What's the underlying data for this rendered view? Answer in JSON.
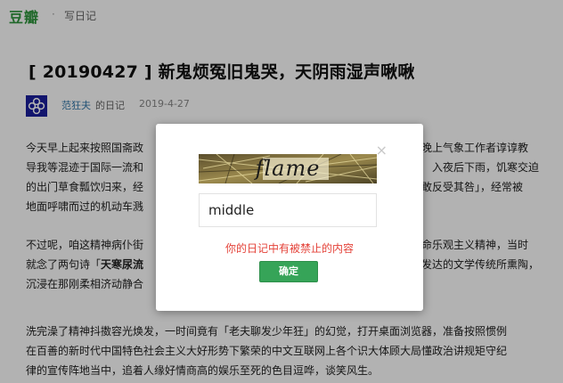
{
  "nav": {
    "logo": "豆瓣",
    "separator": "·",
    "write": "写日记"
  },
  "post": {
    "title": "[ 20190427 ] 新鬼烦冤旧鬼哭，天阴雨湿声啾啾",
    "author": "范狂夫",
    "author_suffix": "的日记",
    "date": "2019-4-27"
  },
  "body": {
    "p1": [
      "今天早上起来按照国斋政",
      "导我等混迹于国际一流和",
      "的出门草食瓢饮归来，经",
      "地面呼啸而过的机动车溅"
    ],
    "p1_right": [
      "天晚上气象工作者谆谆教",
      "入夜后下雨，饥寒交迫",
      "不敢反受其咎」，经常被",
      ""
    ],
    "p2_line1_left": "不过呢，咱这精神病仆街",
    "p2_line1_right": "革命乐观主义精神，当时",
    "p2_line2_left": "就念了两句诗「",
    "p2_line2_bold": "天寒尿流",
    "p2_line2_right": "发达的文学传统所熏陶，",
    "p2_line3": "沉浸在那刚柔相济动静合",
    "p3": [
      "洗完澡了精神抖擞容光焕发，一时间竟有「老夫聊发少年狂」的幻觉，打开桌面浏览器，准备按照惯例",
      "在百善的新时代中国特色社会主义大好形势下繁荣的中文互联网上各个识大体顾大局懂政治讲规矩守纪",
      "律的宣传阵地当中，追着人缘好情商高的娱乐至死的色目逗哗，谈笑风生。"
    ]
  },
  "modal": {
    "close_glyph": "×",
    "captcha_text": "flame",
    "input_value": "middle",
    "error": "你的日记中有被禁止的内容",
    "confirm": "确定"
  },
  "colors": {
    "brand_green": "#2e963d",
    "button_green": "#36a458",
    "error_red": "#e4433a",
    "link_blue": "#3377aa"
  },
  "icons": {
    "avatar": "blue-square-avatar-icon"
  }
}
